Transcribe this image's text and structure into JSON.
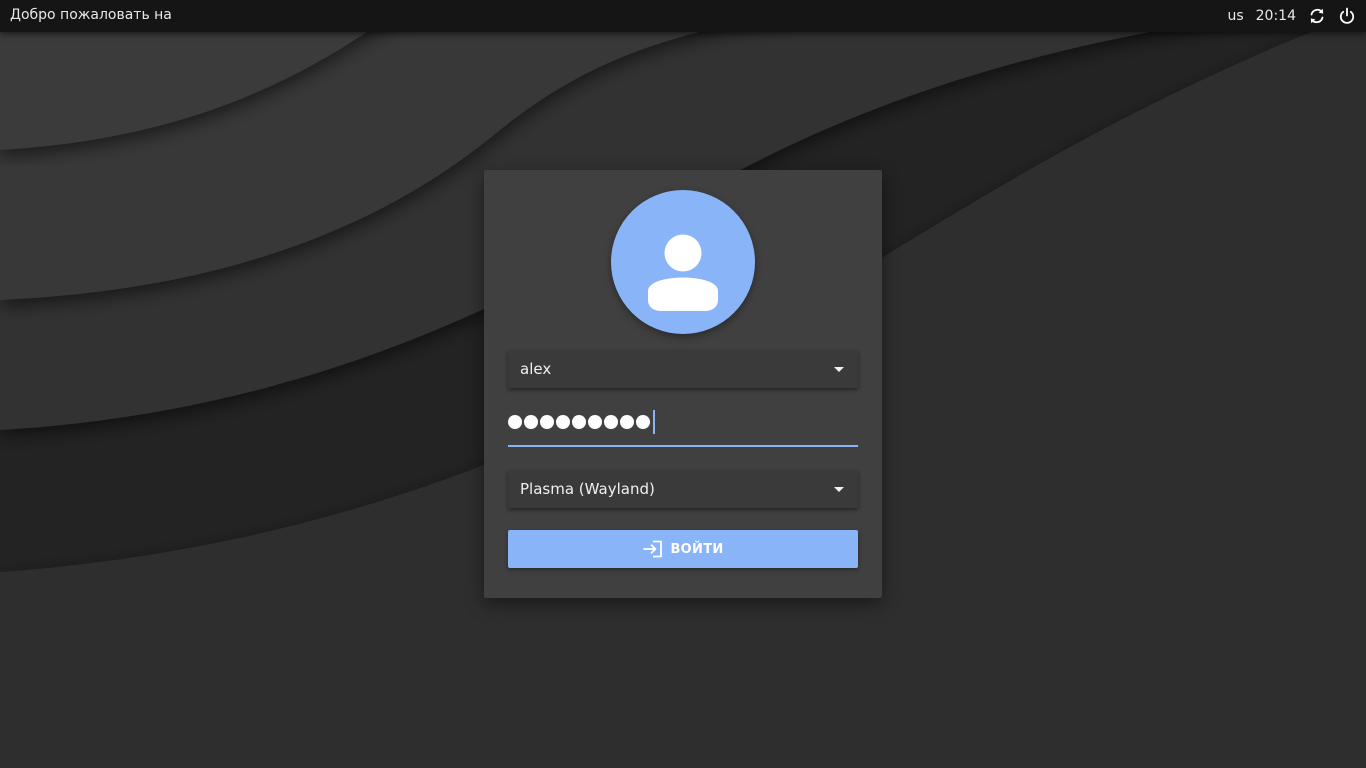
{
  "topbar": {
    "welcome": "Добро пожаловать на",
    "keyboard_layout": "us",
    "clock": "20:14",
    "icons": [
      "refresh-icon",
      "power-icon"
    ]
  },
  "login": {
    "username": "alex",
    "password_length": 9,
    "session": "Plasma (Wayland)",
    "login_label": "ВОЙТИ",
    "login_icon": "login-icon",
    "avatar_icon": "user-icon"
  },
  "colors": {
    "accent": "#8ab4f8",
    "card": "#404040",
    "topbar": "#151515",
    "background": "#252525"
  }
}
